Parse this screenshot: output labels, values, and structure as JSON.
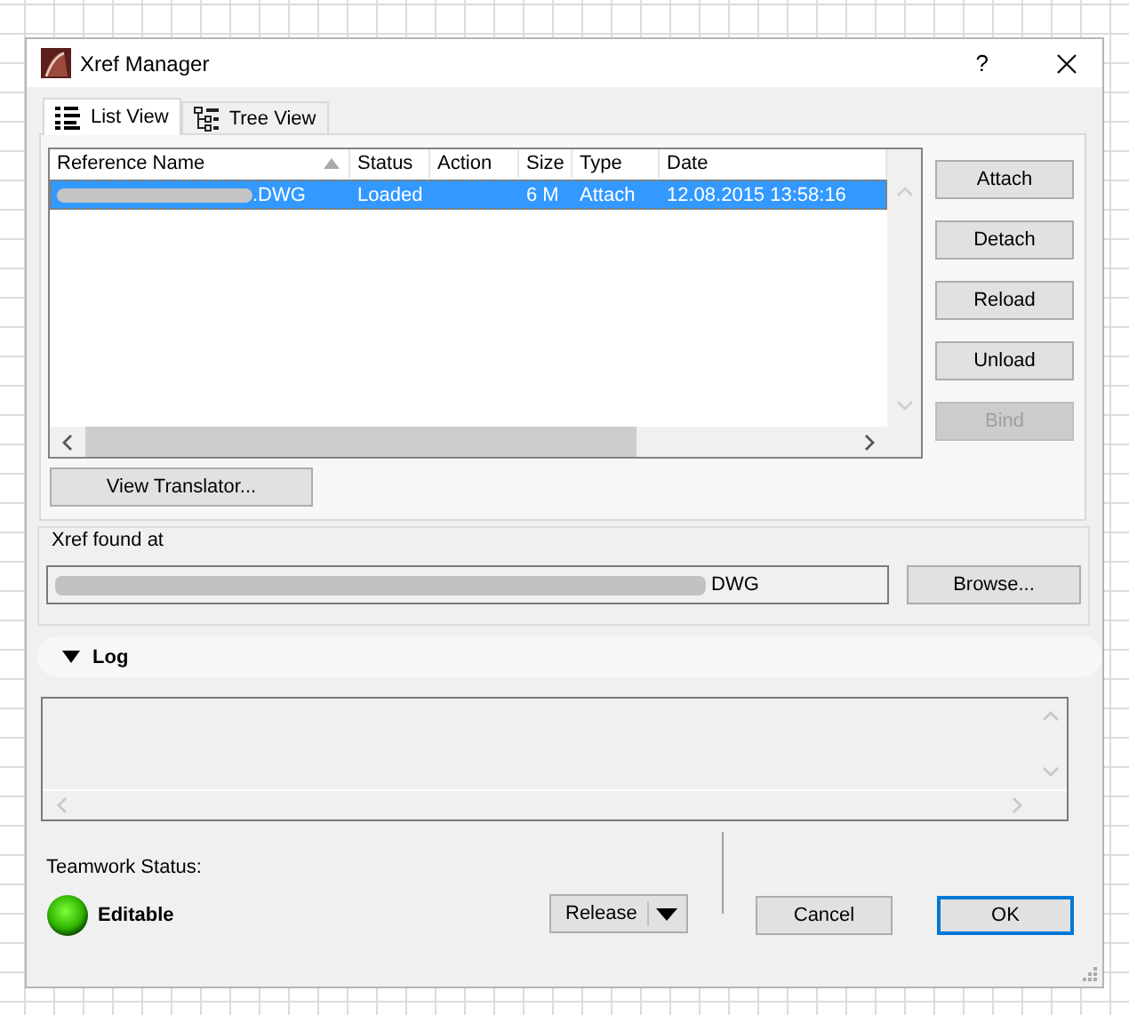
{
  "window": {
    "title": "Xref Manager",
    "help": "?"
  },
  "tabs": [
    {
      "label": "List View",
      "kind": "list",
      "selected": true
    },
    {
      "label": "Tree View",
      "kind": "tree",
      "selected": false
    }
  ],
  "table": {
    "columns": [
      {
        "label": "Reference Name",
        "sorted": true
      },
      {
        "label": "Status",
        "sorted": false
      },
      {
        "label": "Action",
        "sorted": false
      },
      {
        "label": "Size",
        "sorted": false
      },
      {
        "label": "Type",
        "sorted": false
      },
      {
        "label": "Date",
        "sorted": false
      }
    ],
    "rows": [
      {
        "reference_name": ".DWG",
        "name_redacted": true,
        "status": "Loaded",
        "size": "6 M",
        "type": "Attach",
        "date": "12.08.2015 13:58:16",
        "selected": true
      }
    ]
  },
  "side_buttons": [
    {
      "label": "Attach",
      "disabled": false
    },
    {
      "label": "Detach",
      "disabled": false
    },
    {
      "label": "Reload",
      "disabled": false
    },
    {
      "label": "Unload",
      "disabled": false
    },
    {
      "label": "Bind",
      "disabled": true
    }
  ],
  "view_translator_button": "View Translator...",
  "xref_found_at": {
    "label": "Xref found at",
    "path": "DWG",
    "path_redacted": true,
    "button": "Browse..."
  },
  "log": {
    "title": "Log",
    "expanded": true
  },
  "teamwork": {
    "label": "Teamwork Status:",
    "status": "Editable"
  },
  "release_button": "Release",
  "cancel_button": "Cancel",
  "ok_button": {
    "label": "OK",
    "default": true
  }
}
